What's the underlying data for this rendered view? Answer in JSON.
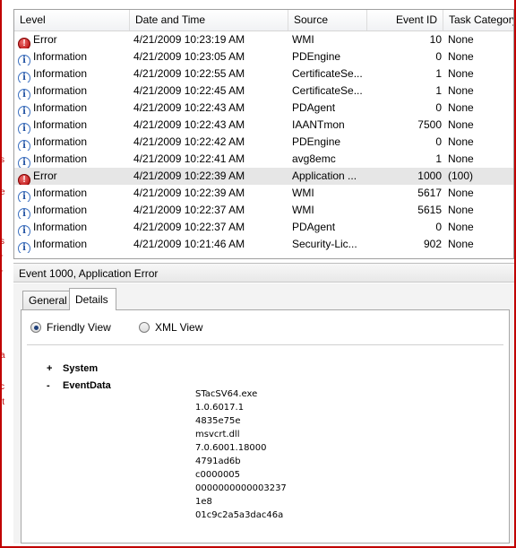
{
  "grid": {
    "columns": {
      "level": "Level",
      "date": "Date and Time",
      "source": "Source",
      "event_id": "Event ID",
      "task": "Task Category"
    },
    "rows": [
      {
        "level": "Error",
        "icon": "error-icon",
        "date": "4/21/2009 10:23:19 AM",
        "source": "WMI",
        "event_id": "10",
        "task": "None"
      },
      {
        "level": "Information",
        "icon": "information-icon",
        "date": "4/21/2009 10:23:05 AM",
        "source": "PDEngine",
        "event_id": "0",
        "task": "None"
      },
      {
        "level": "Information",
        "icon": "information-icon",
        "date": "4/21/2009 10:22:55 AM",
        "source": "CertificateSe...",
        "event_id": "1",
        "task": "None"
      },
      {
        "level": "Information",
        "icon": "information-icon",
        "date": "4/21/2009 10:22:45 AM",
        "source": "CertificateSe...",
        "event_id": "1",
        "task": "None"
      },
      {
        "level": "Information",
        "icon": "information-icon",
        "date": "4/21/2009 10:22:43 AM",
        "source": "PDAgent",
        "event_id": "0",
        "task": "None"
      },
      {
        "level": "Information",
        "icon": "information-icon",
        "date": "4/21/2009 10:22:43 AM",
        "source": "IAANTmon",
        "event_id": "7500",
        "task": "None"
      },
      {
        "level": "Information",
        "icon": "information-icon",
        "date": "4/21/2009 10:22:42 AM",
        "source": "PDEngine",
        "event_id": "0",
        "task": "None"
      },
      {
        "level": "Information",
        "icon": "information-icon",
        "date": "4/21/2009 10:22:41 AM",
        "source": "avg8emc",
        "event_id": "1",
        "task": "None"
      },
      {
        "level": "Error",
        "icon": "error-icon",
        "date": "4/21/2009 10:22:39 AM",
        "source": "Application ...",
        "event_id": "1000",
        "task": "(100)",
        "selected": true
      },
      {
        "level": "Information",
        "icon": "information-icon",
        "date": "4/21/2009 10:22:39 AM",
        "source": "WMI",
        "event_id": "5617",
        "task": "None"
      },
      {
        "level": "Information",
        "icon": "information-icon",
        "date": "4/21/2009 10:22:37 AM",
        "source": "WMI",
        "event_id": "5615",
        "task": "None"
      },
      {
        "level": "Information",
        "icon": "information-icon",
        "date": "4/21/2009 10:22:37 AM",
        "source": "PDAgent",
        "event_id": "0",
        "task": "None"
      },
      {
        "level": "Information",
        "icon": "information-icon",
        "date": "4/21/2009 10:21:46 AM",
        "source": "Security-Lic...",
        "event_id": "902",
        "task": "None"
      }
    ]
  },
  "detail": {
    "title": "Event 1000, Application Error",
    "tabs": [
      "General",
      "Details"
    ],
    "active_tab": "Details",
    "view_options": {
      "friendly": "Friendly View",
      "xml": "XML View",
      "selected": "Friendly View"
    },
    "tree": [
      {
        "toggle": "+",
        "label": "System"
      },
      {
        "toggle": "-",
        "label": "EventData"
      }
    ],
    "event_data": [
      "STacSV64.exe",
      "1.0.6017.1",
      "4835e75e",
      "msvcrt.dll",
      "7.0.6001.18000",
      "4791ad6b",
      "c0000005",
      "0000000000003237",
      "1e8",
      "01c9c2a5a3dac46a"
    ]
  },
  "background_fragments": [
    "s",
    "e",
    "s",
    "r",
    "r",
    "a",
    "c",
    "it"
  ],
  "colors": {
    "error": "#b00000",
    "information": "#1e4fa0",
    "frame_border": "#c00000",
    "selected_row": "#e6e6e6"
  }
}
